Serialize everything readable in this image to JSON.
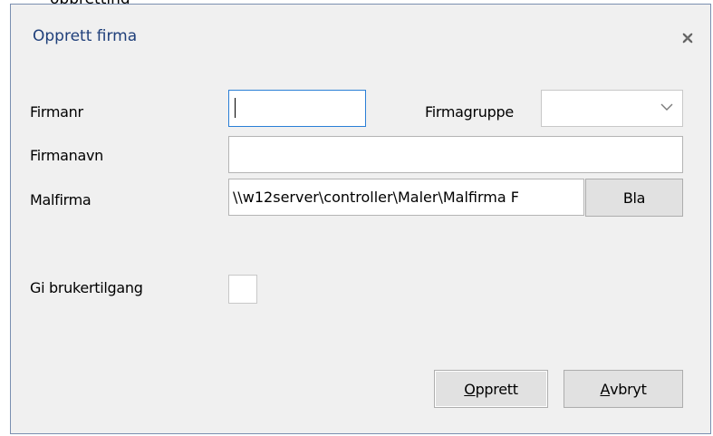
{
  "background_hint": "oppretting",
  "dialog": {
    "title": "Opprett firma",
    "close_icon": "close-x-icon"
  },
  "form": {
    "firmanr_label": "Firmanr",
    "firmanr_value": "",
    "firmagruppe_label": "Firmagruppe",
    "firmagruppe_value": "",
    "firmanavn_label": "Firmanavn",
    "firmanavn_value": "",
    "malfirma_label": "Malfirma",
    "malfirma_value": "\\\\w12server\\controller\\Maler\\Malfirma F",
    "browse_label": "Bla",
    "brukertilgang_label": "Gi brukertilgang",
    "brukertilgang_checked": false
  },
  "actions": {
    "create_prefix": "O",
    "create_rest": "pprett",
    "cancel_prefix": "A",
    "cancel_rest": "vbryt"
  },
  "colors": {
    "title_text": "#1f3f7a",
    "focus_border": "#2a7fd6",
    "dialog_border": "#7a8fb0",
    "dialog_bg": "#f0f0f0"
  }
}
